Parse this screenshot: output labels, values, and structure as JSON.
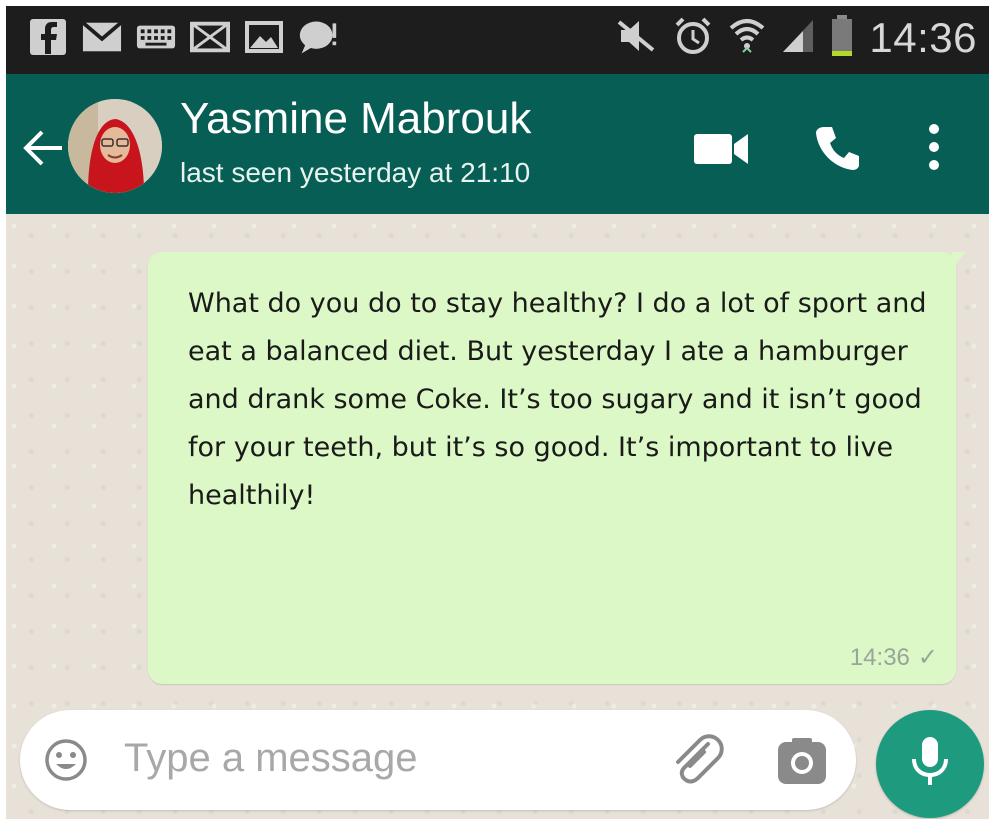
{
  "status_bar": {
    "time": "14:36",
    "left_icons": [
      "facebook-icon",
      "email-icon",
      "keyboard-icon",
      "mail-icon",
      "image-icon",
      "chat-bubble-icon"
    ],
    "right_icons": [
      "mute-icon",
      "alarm-icon",
      "wifi-icon",
      "signal-icon",
      "battery-icon"
    ]
  },
  "header": {
    "contact_name": "Yasmine Mabrouk",
    "last_seen": "last seen yesterday at 21:10",
    "accent_color": "#075e54"
  },
  "conversation": {
    "messages": [
      {
        "text": "What do you do to stay healthy? I do a lot of sport and eat a balanced diet. But yesterday I ate a hamburger and drank some Coke. It’s too sugary and it isn’t good for your teeth, but it’s so good. It’s important to live healthily!",
        "time": "14:36",
        "status": "✓",
        "bubble_color": "#dcf8c6"
      }
    ]
  },
  "composer": {
    "placeholder": "Type a message",
    "mic_color": "#1e9b7f"
  }
}
